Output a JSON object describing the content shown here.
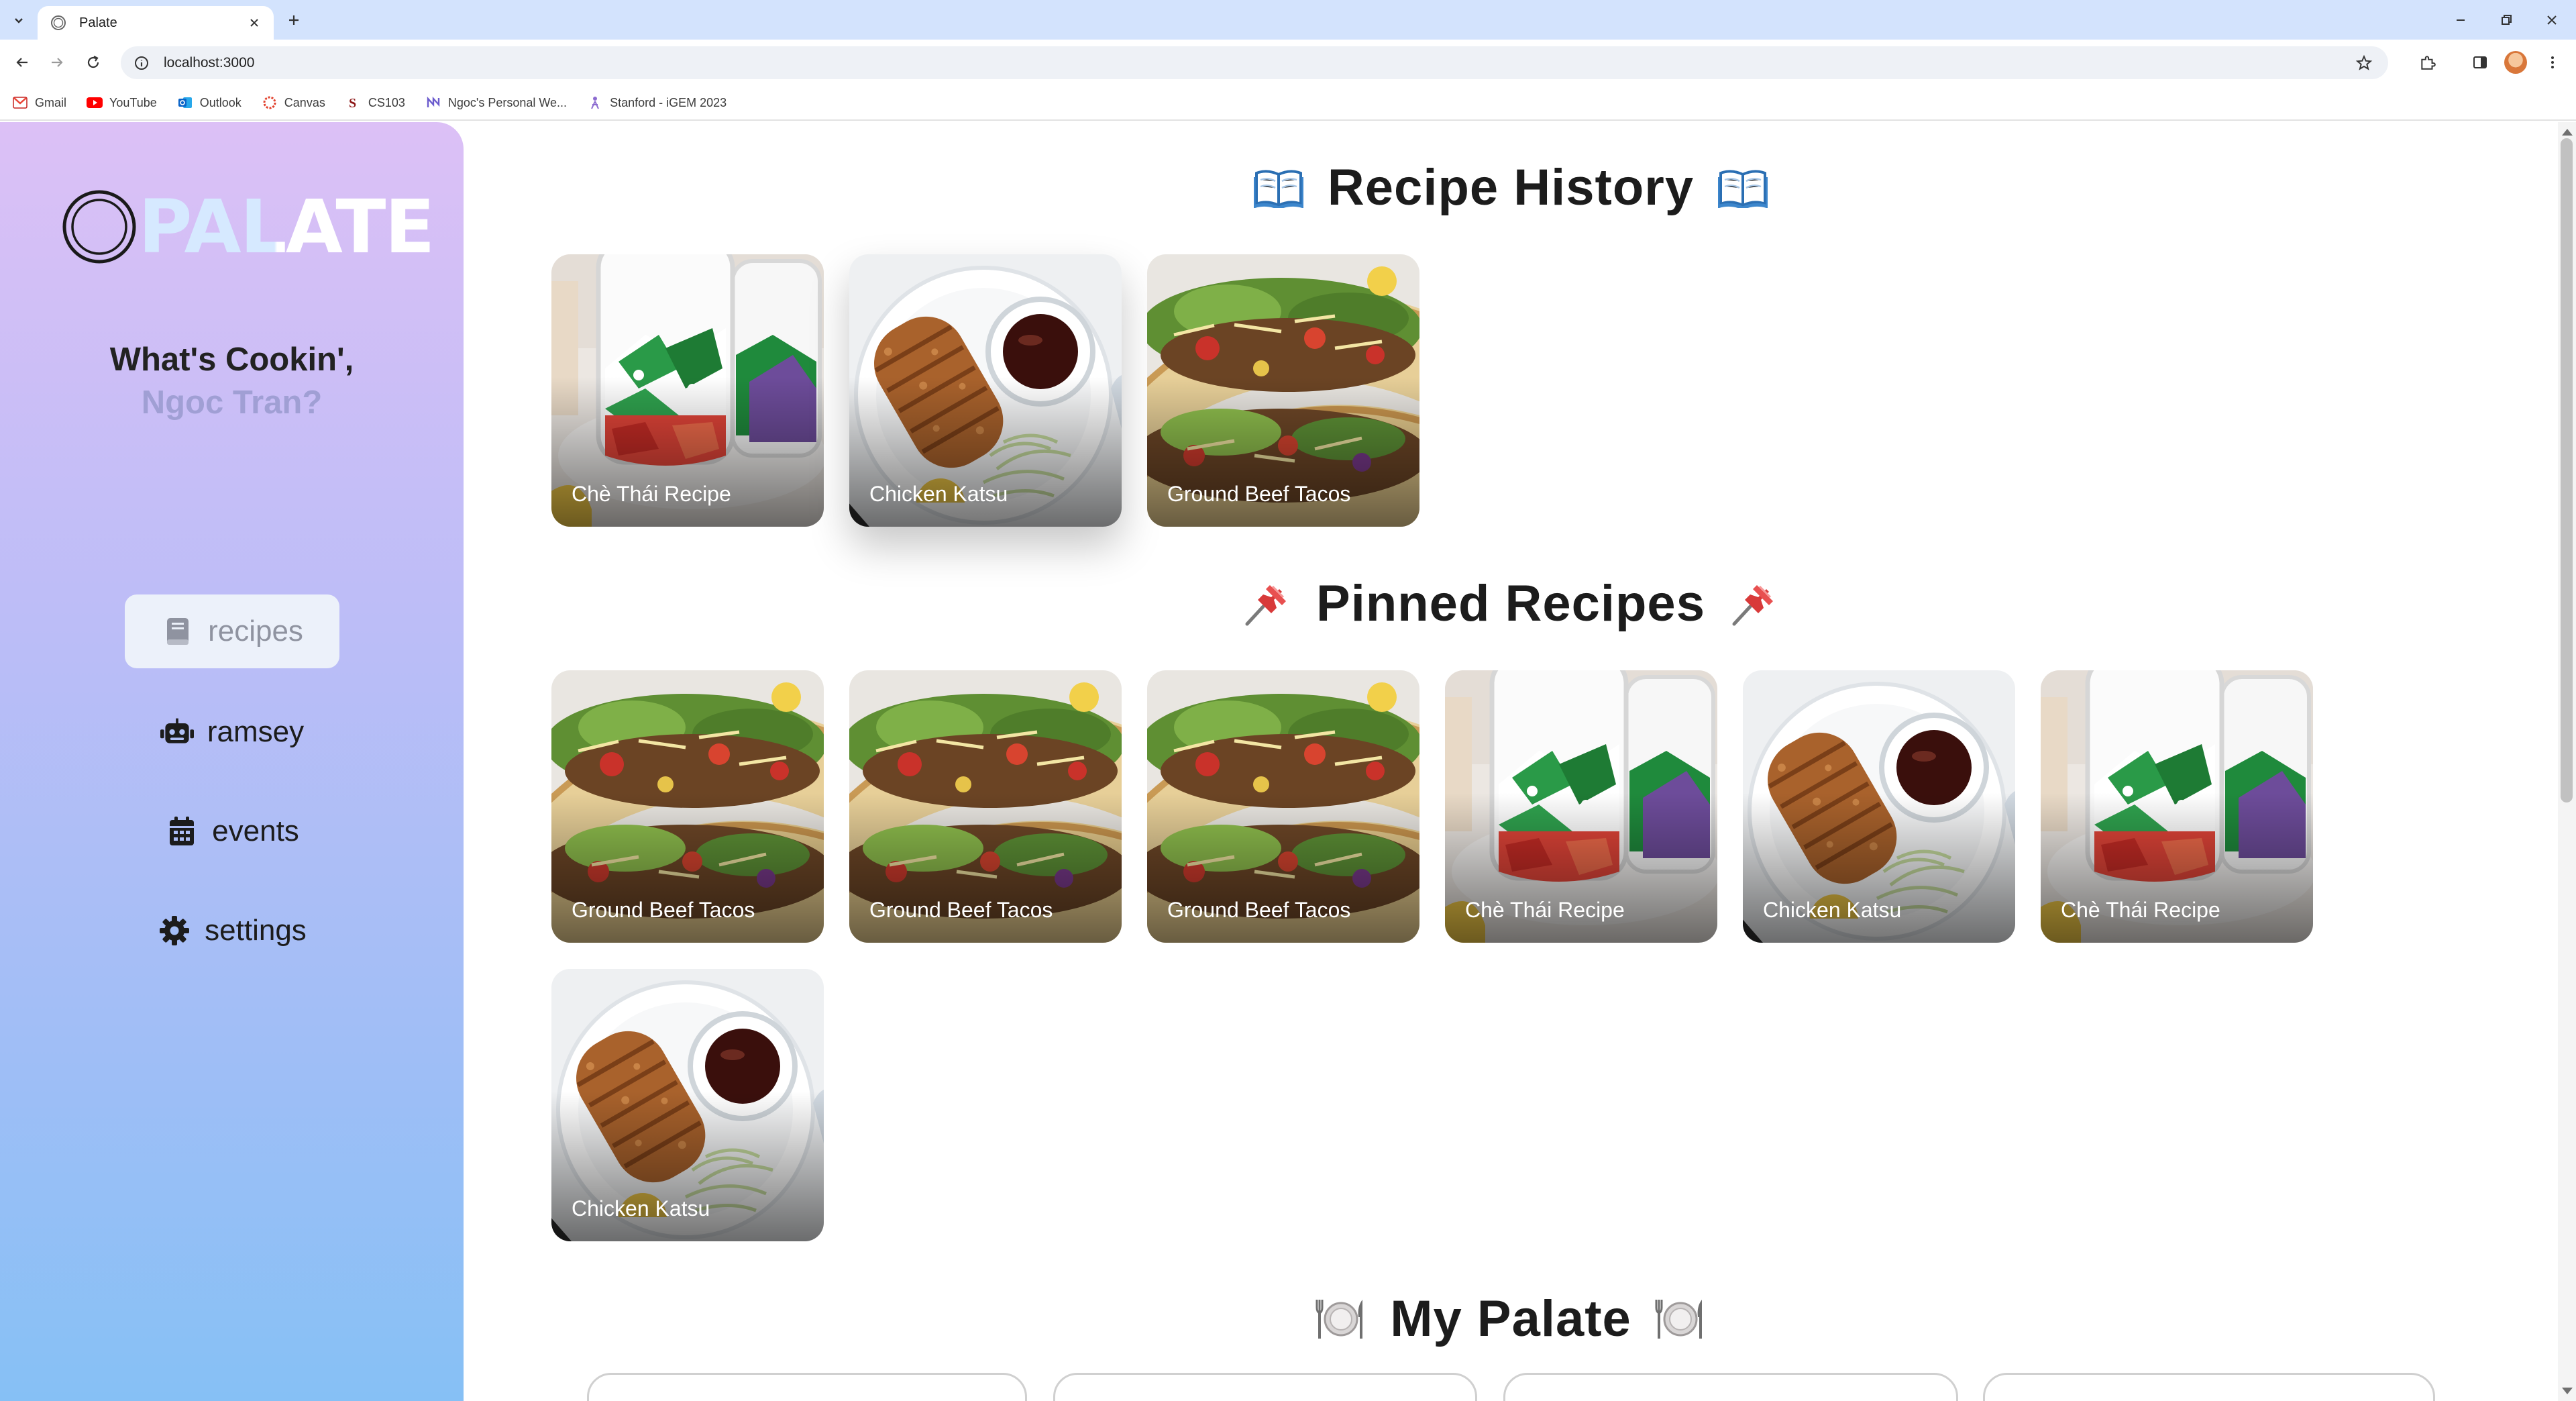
{
  "browser": {
    "tab_title": "Palate",
    "url": "localhost:3000",
    "bookmarks": [
      "Gmail",
      "YouTube",
      "Outlook",
      "Canvas",
      "CS103",
      "Ngoc's Personal We...",
      "Stanford - iGEM 2023"
    ]
  },
  "sidebar": {
    "logo_text": "PALATE",
    "greeting_line1": "What's Cookin',",
    "greeting_name": "Ngoc Tran?",
    "nav": [
      {
        "label": "recipes",
        "icon": "book-icon",
        "active": true
      },
      {
        "label": "ramsey",
        "icon": "robot-icon",
        "active": false
      },
      {
        "label": "events",
        "icon": "calendar-icon",
        "active": false
      },
      {
        "label": "settings",
        "icon": "gear-icon",
        "active": false
      }
    ]
  },
  "sections": {
    "history": {
      "title": "Recipe History",
      "emoji": "open-book-icon",
      "cards": [
        "Chè Thái Recipe",
        "Chicken Katsu",
        "Ground Beef Tacos"
      ]
    },
    "pinned": {
      "title": "Pinned Recipes",
      "emoji": "pushpin-icon",
      "cards": [
        "Ground Beef Tacos",
        "Ground Beef Tacos",
        "Ground Beef Tacos",
        "Chè Thái Recipe",
        "Chicken Katsu",
        "Chè Thái Recipe",
        "Chicken Katsu"
      ]
    },
    "palate": {
      "title": "My Palate",
      "emoji": "plate-cutlery-icon"
    }
  },
  "colors": {
    "sidebar_top": "#dcc0f6",
    "sidebar_bottom": "#86c0f5",
    "active_nav_bg": "#ecf1fa",
    "greeting_name": "#a09fd4",
    "browser_frame": "#d3e3fd"
  }
}
